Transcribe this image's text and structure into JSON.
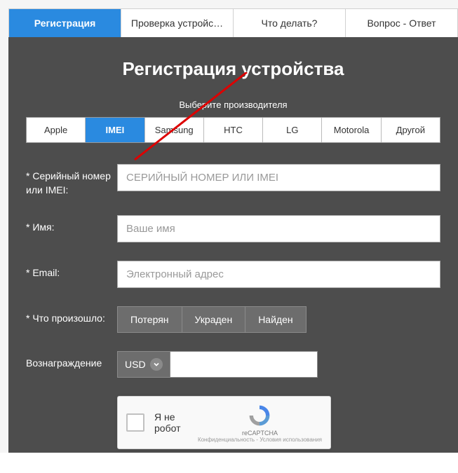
{
  "tabs": [
    {
      "label": "Регистрация",
      "active": true
    },
    {
      "label": "Проверка устройс…",
      "active": false
    },
    {
      "label": "Что делать?",
      "active": false
    },
    {
      "label": "Вопрос - Ответ",
      "active": false
    }
  ],
  "title": "Регистрация устройства",
  "subtitle": "Выберите производителя",
  "makers": [
    {
      "label": "Apple",
      "active": false
    },
    {
      "label": "IMEI",
      "active": true
    },
    {
      "label": "Samsung",
      "active": false
    },
    {
      "label": "HTC",
      "active": false
    },
    {
      "label": "LG",
      "active": false
    },
    {
      "label": "Motorola",
      "active": false
    },
    {
      "label": "Другой",
      "active": false
    }
  ],
  "form": {
    "serial_label": "* Серийный номер или IMEI:",
    "serial_placeholder": "СЕРИЙНЫЙ НОМЕР ИЛИ IMEI",
    "name_label": "* Имя:",
    "name_placeholder": "Ваше имя",
    "email_label": "* Email:",
    "email_placeholder": "Электронный адрес",
    "what_label": "* Что произошло:",
    "what_options": [
      "Потерян",
      "Украден",
      "Найден"
    ],
    "reward_label": "Вознаграждение",
    "currency": "USD"
  },
  "recaptcha": {
    "label": "Я не робот",
    "brand": "reCAPTCHA",
    "terms": "Конфиденциальность - Условия использования"
  }
}
